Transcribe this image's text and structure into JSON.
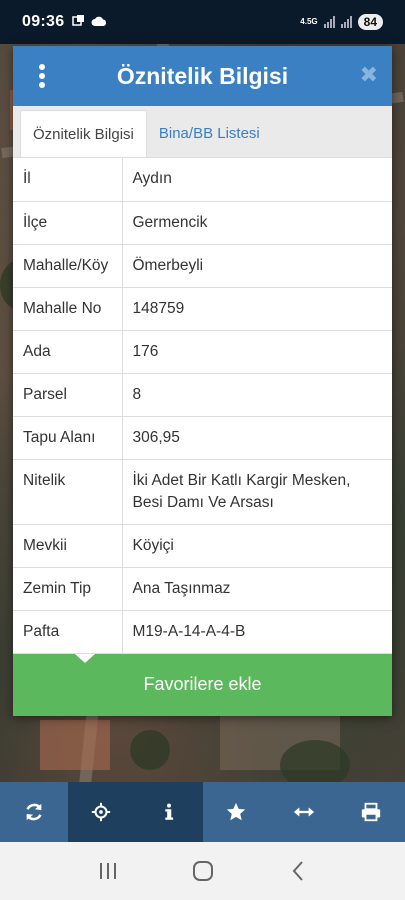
{
  "status_bar": {
    "time": "09:36",
    "network_type": "4.5G",
    "battery": "84"
  },
  "modal": {
    "title": "Öznitelik Bilgisi",
    "tabs": [
      {
        "label": "Öznitelik Bilgisi",
        "active": true
      },
      {
        "label": "Bina/BB Listesi",
        "active": false
      }
    ],
    "rows": [
      {
        "key": "İl",
        "value": "Aydın"
      },
      {
        "key": "İlçe",
        "value": "Germencik"
      },
      {
        "key": "Mahalle/Köy",
        "value": "Ömerbeyli"
      },
      {
        "key": "Mahalle No",
        "value": "148759"
      },
      {
        "key": "Ada",
        "value": "176"
      },
      {
        "key": "Parsel",
        "value": "8"
      },
      {
        "key": "Tapu Alanı",
        "value": "306,95"
      },
      {
        "key": "Nitelik",
        "value": "İki Adet Bir Katlı Kargir Mesken, Besi Damı Ve Arsası"
      },
      {
        "key": "Mevkii",
        "value": "Köyiçi"
      },
      {
        "key": "Zemin Tip",
        "value": "Ana Taşınmaz"
      },
      {
        "key": "Pafta",
        "value": "M19-A-14-A-4-B"
      }
    ],
    "favorite_button": "Favorilere ekle"
  },
  "toolbar": {
    "items": [
      "refresh-icon",
      "locate-icon",
      "info-icon",
      "star-icon",
      "measure-icon",
      "print-icon"
    ]
  },
  "colors": {
    "header": "#3a80c3",
    "button": "#5cb85c",
    "toolbar": "#3b6692",
    "toolbar_active": "#1f3f5f"
  }
}
